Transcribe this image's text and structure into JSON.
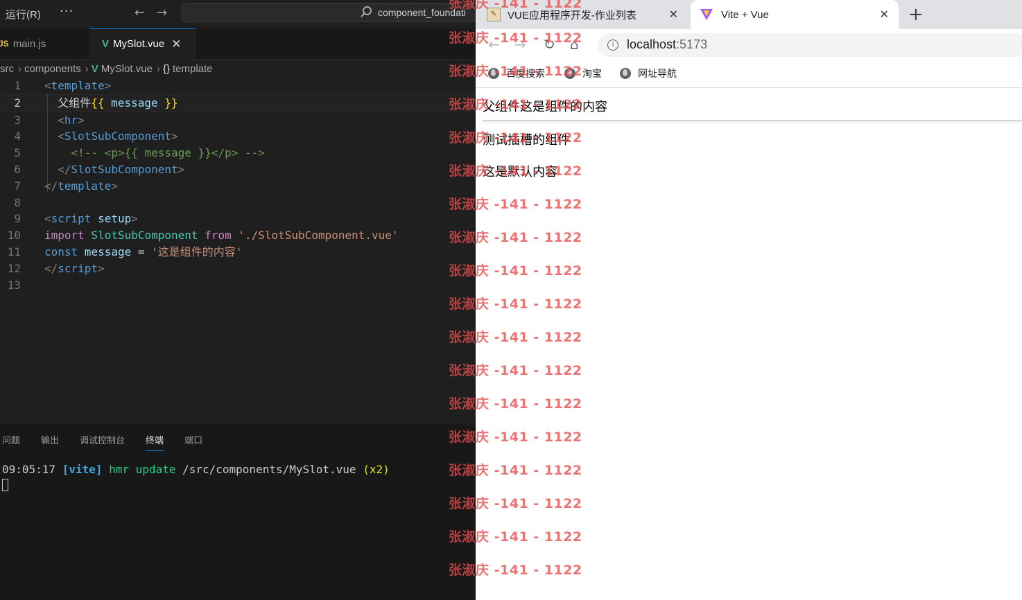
{
  "vscode": {
    "menu_run": "运行(R)",
    "menu_more": "···",
    "search_text": "component_foundati",
    "tabs": [
      {
        "label": "main.js",
        "icon": "JS"
      },
      {
        "label": "MySlot.vue",
        "icon": "V"
      }
    ],
    "breadcrumb": [
      "src",
      "components",
      "MySlot.vue",
      "template"
    ],
    "code_lines": [
      "1",
      "2",
      "3",
      "4",
      "5",
      "6",
      "7",
      "8",
      "9",
      "10",
      "11",
      "12",
      "13"
    ],
    "code": {
      "l1_open": "<",
      "l1_tag": "template",
      "l1_close": ">",
      "l2_text": "父组件",
      "l2_mo": "{{",
      "l2_var": " message ",
      "l2_mc": "}}",
      "l3_open": "<",
      "l3_tag": "hr",
      "l3_close": ">",
      "l4_open": "<",
      "l4_tag": "SlotSubComponent",
      "l4_close": ">",
      "l5_comment": "<!-- <p>{{ message }}</p> -->",
      "l6_open": "</",
      "l6_tag": "SlotSubComponent",
      "l6_close": ">",
      "l7_open": "</",
      "l7_tag": "template",
      "l7_close": ">",
      "l9_open": "<",
      "l9_tag": "script",
      "l9_attr": " setup",
      "l9_close": ">",
      "l10_import": "import",
      "l10_comp": " SlotSubComponent ",
      "l10_from": "from",
      "l10_str": " './SlotSubComponent.vue'",
      "l11_const": "const",
      "l11_var": " message ",
      "l11_eq": "= ",
      "l11_str": "'这是组件的内容'",
      "l12_open": "</",
      "l12_tag": "script",
      "l12_close": ">"
    },
    "panel_tabs": [
      "问题",
      "输出",
      "调试控制台",
      "终端",
      "端口"
    ],
    "terminal": {
      "time": "09:05:17 ",
      "vite": "[vite]",
      "hmr": " hmr update",
      "path": " /src/components/MySlot.vue ",
      "count": "(x2)"
    }
  },
  "browser": {
    "tabs": [
      {
        "title": "VUE应用程序开发-作业列表"
      },
      {
        "title": "Vite + Vue"
      }
    ],
    "new_tab": "+",
    "url_host": "localhost",
    "url_port": ":5173",
    "bookmarks": [
      "百度搜索",
      "淘宝",
      "网址导航"
    ],
    "page": {
      "parent_text": "父组件这是组件的内容",
      "test_text": "测试插槽的组件",
      "default_text": "这是默认内容"
    }
  },
  "watermark": "张淑庆 -141 - 1122",
  "colors": {
    "accent": "#0078d4",
    "vue_green": "#41b883",
    "watermark_red": "#e74c4c"
  }
}
